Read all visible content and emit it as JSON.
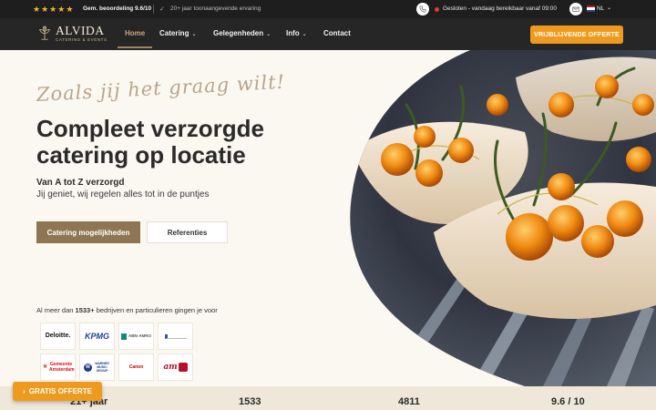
{
  "topbar": {
    "rating_text": "Gem. beoordeling 9.6/10",
    "experience_text": "20+ jaar toonaangevende ervaring",
    "status_text": "Gesloten - vandaag bereikbaar vanaf 09:00",
    "language": "NL",
    "stars": 5
  },
  "brand": {
    "name": "ALVIDA",
    "tagline": "CATERING & EVENTS"
  },
  "nav": {
    "items": [
      {
        "label": "Home"
      },
      {
        "label": "Catering"
      },
      {
        "label": "Gelegenheden"
      },
      {
        "label": "Info"
      },
      {
        "label": "Contact"
      }
    ],
    "cta_label": "VRIJBLIJVENDE OFFERTE"
  },
  "hero": {
    "script_text": "Zoals jij het graag wilt!",
    "headline": "Compleet verzorgde catering op locatie",
    "subtitle_strong": "Van A tot Z verzorgd",
    "subtitle": "Jij geniet, wij regelen alles tot in de puntjes",
    "primary_button": "Catering mogelijkheden",
    "secondary_button": "Referenties"
  },
  "clients": {
    "prefix": "Al meer dan ",
    "count": "1533+",
    "suffix": " bedrijven en particulieren gingen je voor",
    "logos": [
      {
        "label": "Deloitte."
      },
      {
        "label": "KPMG"
      },
      {
        "label": "ABN·AMRO"
      },
      {
        "label": ""
      },
      {
        "label": "Gemeente Amsterdam"
      },
      {
        "label": "WARNER MUSIC GROUP"
      },
      {
        "label": "Canon"
      },
      {
        "label": "am"
      }
    ]
  },
  "stats": {
    "years": "21+ jaar",
    "clients": "1533",
    "events": "4811",
    "rating": "9.6 / 10"
  },
  "floating_cta": "GRATIS OFFERTE",
  "colors": {
    "accent_orange": "#ee9a1e",
    "brand_brown": "#8f7652",
    "dark_bar": "#1e1e1e",
    "status_closed": "#e53935"
  }
}
